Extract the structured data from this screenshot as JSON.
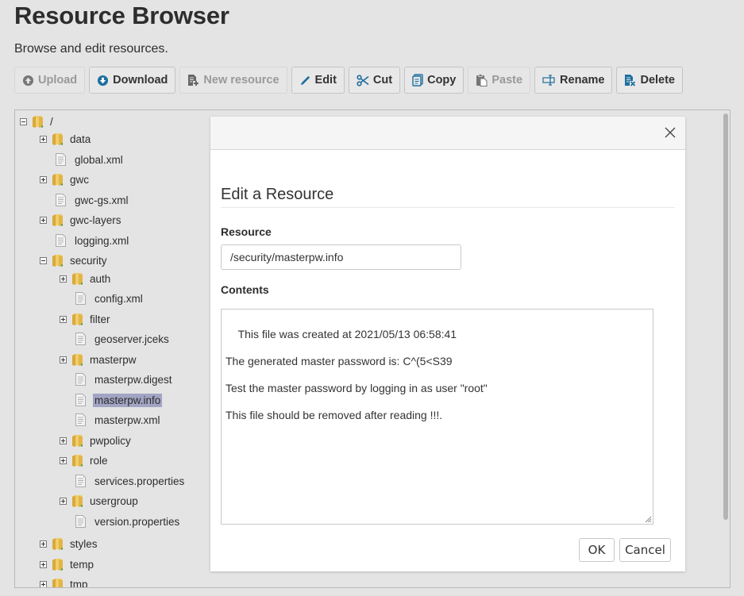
{
  "page": {
    "title": "Resource Browser",
    "description": "Browse and edit resources."
  },
  "toolbar": {
    "buttons": [
      {
        "id": "upload",
        "label": "Upload",
        "icon": "upload-icon",
        "enabled": false
      },
      {
        "id": "download",
        "label": "Download",
        "icon": "download-icon",
        "enabled": true
      },
      {
        "id": "new-resource",
        "label": "New resource",
        "icon": "new-file-icon",
        "enabled": false
      },
      {
        "id": "edit",
        "label": "Edit",
        "icon": "pencil-icon",
        "enabled": true
      },
      {
        "id": "cut",
        "label": "Cut",
        "icon": "scissors-icon",
        "enabled": true
      },
      {
        "id": "copy",
        "label": "Copy",
        "icon": "copy-icon",
        "enabled": true
      },
      {
        "id": "paste",
        "label": "Paste",
        "icon": "clipboard-icon",
        "enabled": false
      },
      {
        "id": "rename",
        "label": "Rename",
        "icon": "rename-icon",
        "enabled": true
      },
      {
        "id": "delete",
        "label": "Delete",
        "icon": "delete-file-icon",
        "enabled": true
      }
    ]
  },
  "tree": {
    "nodes": [
      {
        "label": "/",
        "type": "folder",
        "depth": 0,
        "toggle": "minus"
      },
      {
        "label": "data",
        "type": "folder",
        "depth": 1,
        "toggle": "plus"
      },
      {
        "label": "global.xml",
        "type": "file",
        "depth": 1
      },
      {
        "label": "gwc",
        "type": "folder",
        "depth": 1,
        "toggle": "plus"
      },
      {
        "label": "gwc-gs.xml",
        "type": "file",
        "depth": 1
      },
      {
        "label": "gwc-layers",
        "type": "folder",
        "depth": 1,
        "toggle": "plus"
      },
      {
        "label": "logging.xml",
        "type": "file",
        "depth": 1
      },
      {
        "label": "security",
        "type": "folder",
        "depth": 1,
        "toggle": "minus"
      },
      {
        "label": "auth",
        "type": "folder",
        "depth": 2,
        "toggle": "plus"
      },
      {
        "label": "config.xml",
        "type": "file",
        "depth": 2
      },
      {
        "label": "filter",
        "type": "folder",
        "depth": 2,
        "toggle": "plus"
      },
      {
        "label": "geoserver.jceks",
        "type": "file",
        "depth": 2
      },
      {
        "label": "masterpw",
        "type": "folder",
        "depth": 2,
        "toggle": "plus"
      },
      {
        "label": "masterpw.digest",
        "type": "file",
        "depth": 2
      },
      {
        "label": "masterpw.info",
        "type": "file",
        "depth": 2,
        "selected": true
      },
      {
        "label": "masterpw.xml",
        "type": "file",
        "depth": 2
      },
      {
        "label": "pwpolicy",
        "type": "folder",
        "depth": 2,
        "toggle": "plus"
      },
      {
        "label": "role",
        "type": "folder",
        "depth": 2,
        "toggle": "plus"
      },
      {
        "label": "services.properties",
        "type": "file",
        "depth": 2
      },
      {
        "label": "usergroup",
        "type": "folder",
        "depth": 2,
        "toggle": "plus"
      },
      {
        "label": "version.properties",
        "type": "file",
        "depth": 2
      },
      {
        "label": "styles",
        "type": "folder",
        "depth": 1,
        "toggle": "plus"
      },
      {
        "label": "temp",
        "type": "folder",
        "depth": 1,
        "toggle": "plus"
      },
      {
        "label": "tmp",
        "type": "folder",
        "depth": 1,
        "toggle": "plus"
      }
    ]
  },
  "dialog": {
    "title": "Edit a Resource",
    "resource_label": "Resource",
    "resource_value": "/security/masterpw.info",
    "contents_label": "Contents",
    "contents_value": "This file was created at 2021/05/13 06:58:41\n\nThe generated master password is: C^(5<S39\n\nTest the master password by logging in as user \"root\"\n\nThis file should be removed after reading !!!.",
    "ok_label": "OK",
    "cancel_label": "Cancel"
  },
  "colors": {
    "accent_icon": "#1f6f9f",
    "selection": "#a2a4c3",
    "folder": "#e8c25a"
  }
}
